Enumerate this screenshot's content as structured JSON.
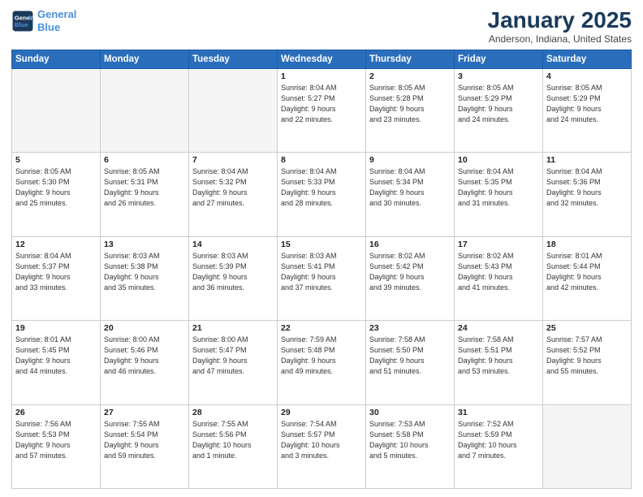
{
  "header": {
    "logo_line1": "General",
    "logo_line2": "Blue",
    "month_title": "January 2025",
    "location": "Anderson, Indiana, United States"
  },
  "weekdays": [
    "Sunday",
    "Monday",
    "Tuesday",
    "Wednesday",
    "Thursday",
    "Friday",
    "Saturday"
  ],
  "weeks": [
    [
      {
        "day": "",
        "info": ""
      },
      {
        "day": "",
        "info": ""
      },
      {
        "day": "",
        "info": ""
      },
      {
        "day": "1",
        "info": "Sunrise: 8:04 AM\nSunset: 5:27 PM\nDaylight: 9 hours\nand 22 minutes."
      },
      {
        "day": "2",
        "info": "Sunrise: 8:05 AM\nSunset: 5:28 PM\nDaylight: 9 hours\nand 23 minutes."
      },
      {
        "day": "3",
        "info": "Sunrise: 8:05 AM\nSunset: 5:29 PM\nDaylight: 9 hours\nand 24 minutes."
      },
      {
        "day": "4",
        "info": "Sunrise: 8:05 AM\nSunset: 5:29 PM\nDaylight: 9 hours\nand 24 minutes."
      }
    ],
    [
      {
        "day": "5",
        "info": "Sunrise: 8:05 AM\nSunset: 5:30 PM\nDaylight: 9 hours\nand 25 minutes."
      },
      {
        "day": "6",
        "info": "Sunrise: 8:05 AM\nSunset: 5:31 PM\nDaylight: 9 hours\nand 26 minutes."
      },
      {
        "day": "7",
        "info": "Sunrise: 8:04 AM\nSunset: 5:32 PM\nDaylight: 9 hours\nand 27 minutes."
      },
      {
        "day": "8",
        "info": "Sunrise: 8:04 AM\nSunset: 5:33 PM\nDaylight: 9 hours\nand 28 minutes."
      },
      {
        "day": "9",
        "info": "Sunrise: 8:04 AM\nSunset: 5:34 PM\nDaylight: 9 hours\nand 30 minutes."
      },
      {
        "day": "10",
        "info": "Sunrise: 8:04 AM\nSunset: 5:35 PM\nDaylight: 9 hours\nand 31 minutes."
      },
      {
        "day": "11",
        "info": "Sunrise: 8:04 AM\nSunset: 5:36 PM\nDaylight: 9 hours\nand 32 minutes."
      }
    ],
    [
      {
        "day": "12",
        "info": "Sunrise: 8:04 AM\nSunset: 5:37 PM\nDaylight: 9 hours\nand 33 minutes."
      },
      {
        "day": "13",
        "info": "Sunrise: 8:03 AM\nSunset: 5:38 PM\nDaylight: 9 hours\nand 35 minutes."
      },
      {
        "day": "14",
        "info": "Sunrise: 8:03 AM\nSunset: 5:39 PM\nDaylight: 9 hours\nand 36 minutes."
      },
      {
        "day": "15",
        "info": "Sunrise: 8:03 AM\nSunset: 5:41 PM\nDaylight: 9 hours\nand 37 minutes."
      },
      {
        "day": "16",
        "info": "Sunrise: 8:02 AM\nSunset: 5:42 PM\nDaylight: 9 hours\nand 39 minutes."
      },
      {
        "day": "17",
        "info": "Sunrise: 8:02 AM\nSunset: 5:43 PM\nDaylight: 9 hours\nand 41 minutes."
      },
      {
        "day": "18",
        "info": "Sunrise: 8:01 AM\nSunset: 5:44 PM\nDaylight: 9 hours\nand 42 minutes."
      }
    ],
    [
      {
        "day": "19",
        "info": "Sunrise: 8:01 AM\nSunset: 5:45 PM\nDaylight: 9 hours\nand 44 minutes."
      },
      {
        "day": "20",
        "info": "Sunrise: 8:00 AM\nSunset: 5:46 PM\nDaylight: 9 hours\nand 46 minutes."
      },
      {
        "day": "21",
        "info": "Sunrise: 8:00 AM\nSunset: 5:47 PM\nDaylight: 9 hours\nand 47 minutes."
      },
      {
        "day": "22",
        "info": "Sunrise: 7:59 AM\nSunset: 5:48 PM\nDaylight: 9 hours\nand 49 minutes."
      },
      {
        "day": "23",
        "info": "Sunrise: 7:58 AM\nSunset: 5:50 PM\nDaylight: 9 hours\nand 51 minutes."
      },
      {
        "day": "24",
        "info": "Sunrise: 7:58 AM\nSunset: 5:51 PM\nDaylight: 9 hours\nand 53 minutes."
      },
      {
        "day": "25",
        "info": "Sunrise: 7:57 AM\nSunset: 5:52 PM\nDaylight: 9 hours\nand 55 minutes."
      }
    ],
    [
      {
        "day": "26",
        "info": "Sunrise: 7:56 AM\nSunset: 5:53 PM\nDaylight: 9 hours\nand 57 minutes."
      },
      {
        "day": "27",
        "info": "Sunrise: 7:55 AM\nSunset: 5:54 PM\nDaylight: 9 hours\nand 59 minutes."
      },
      {
        "day": "28",
        "info": "Sunrise: 7:55 AM\nSunset: 5:56 PM\nDaylight: 10 hours\nand 1 minute."
      },
      {
        "day": "29",
        "info": "Sunrise: 7:54 AM\nSunset: 5:57 PM\nDaylight: 10 hours\nand 3 minutes."
      },
      {
        "day": "30",
        "info": "Sunrise: 7:53 AM\nSunset: 5:58 PM\nDaylight: 10 hours\nand 5 minutes."
      },
      {
        "day": "31",
        "info": "Sunrise: 7:52 AM\nSunset: 5:59 PM\nDaylight: 10 hours\nand 7 minutes."
      },
      {
        "day": "",
        "info": ""
      }
    ]
  ]
}
